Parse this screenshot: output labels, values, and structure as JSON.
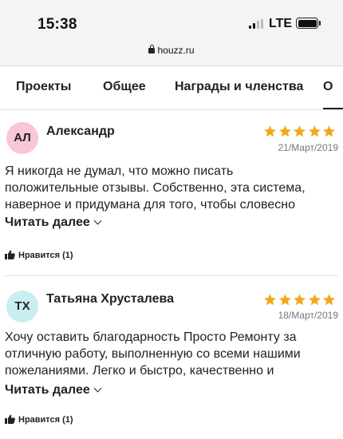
{
  "status_bar": {
    "time": "15:38",
    "carrier": "LTE"
  },
  "browser": {
    "url": "houzz.ru"
  },
  "tabs": [
    "Проекты",
    "Общее",
    "Награды и членства",
    "О"
  ],
  "reviews": [
    {
      "initials": "АЛ",
      "avatar_color": "#f8c6d4",
      "author": "Александр",
      "rating": 5,
      "date": "21/Март/2019",
      "text": [
        "Я никогда не думал, что можно писать",
        "положительные отзывы. Собственно, эта система,",
        "наверное и придумана для того, чтобы словесно"
      ],
      "read_more": "Читать далее",
      "likes": "Нравится (1)"
    },
    {
      "initials": "ТХ",
      "avatar_color": "#c8eef2",
      "author": "Татьяна Хрусталева",
      "rating": 5,
      "date": "18/Март/2019",
      "text": [
        "Хочу оставить благодарность Просто Ремонту за",
        "отличную работу, выполненную со всеми нашими",
        "пожеланиями. Легко и быстро, качественно и"
      ],
      "read_more": "Читать далее",
      "likes": "Нравится (1)"
    }
  ],
  "colors": {
    "star": "#f2a81d",
    "divider": "#e2e2e2"
  }
}
